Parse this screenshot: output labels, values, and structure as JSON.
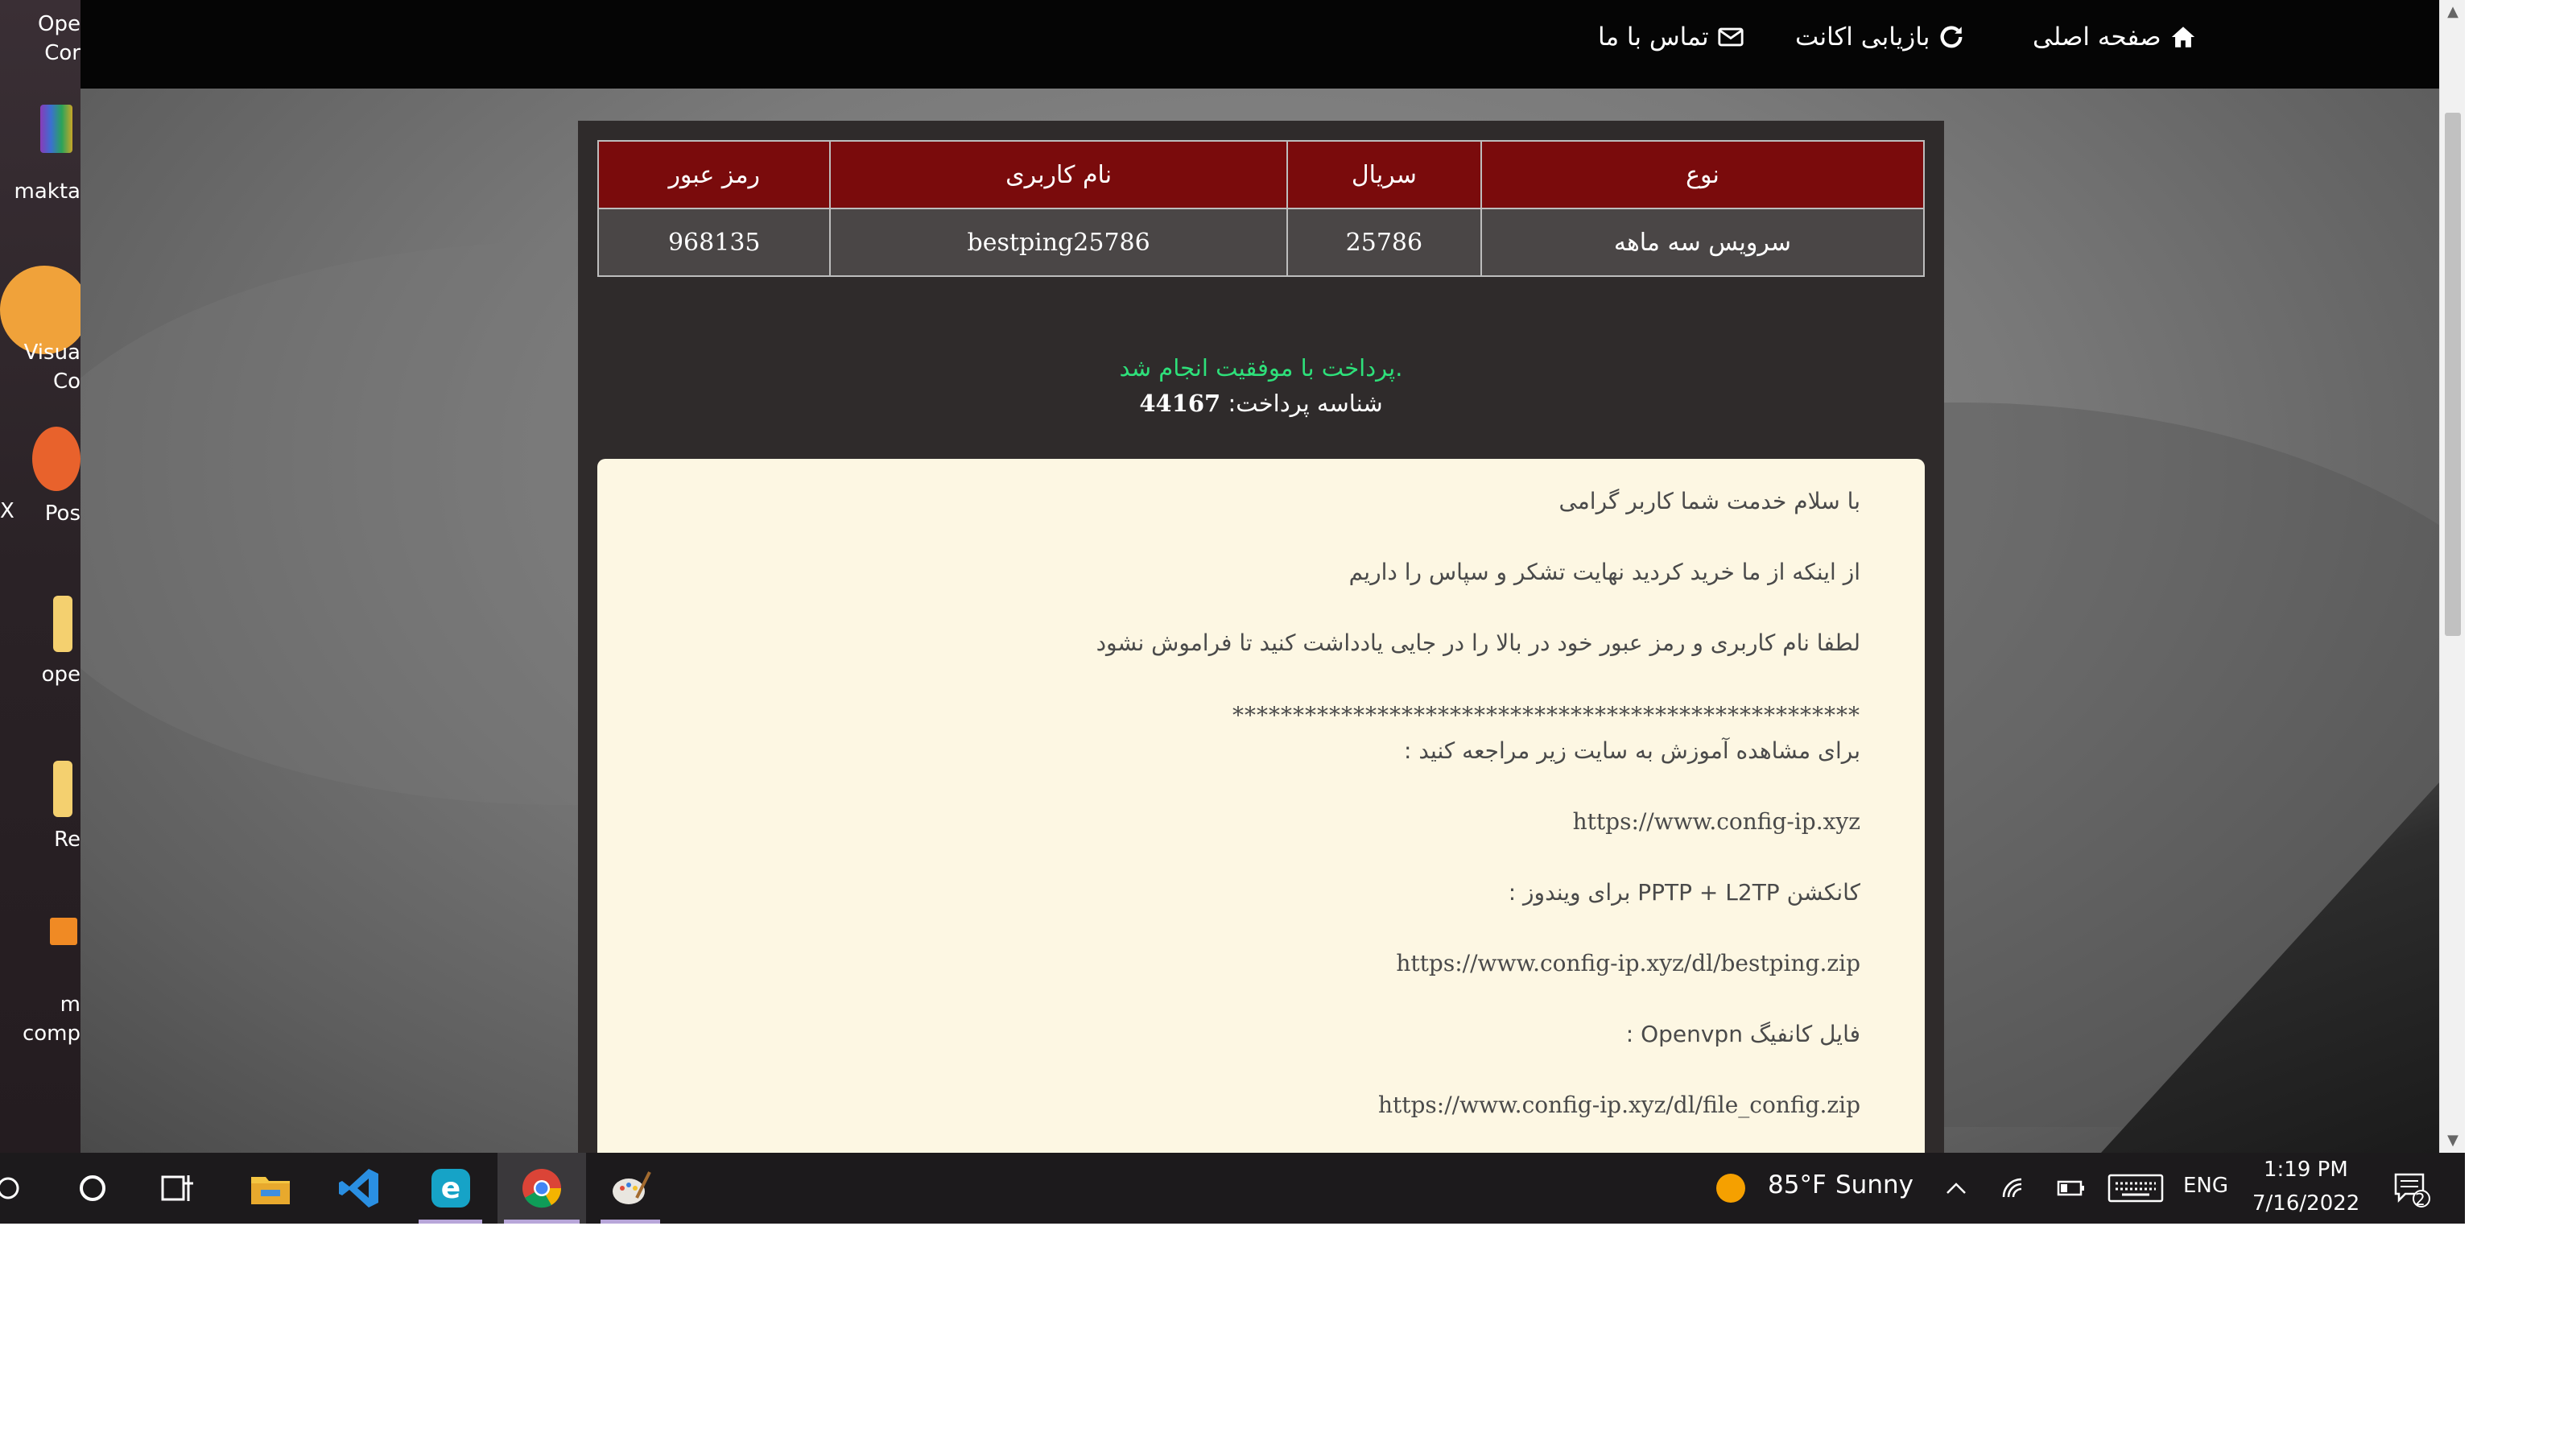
{
  "desktop": {
    "items": [
      {
        "label": "Ope",
        "label2": "Cor"
      },
      {
        "label": "makta"
      },
      {
        "label": "Visua",
        "label2": "Co"
      },
      {
        "label": "X",
        "label2": "Pos"
      },
      {
        "label": "ope"
      },
      {
        "label": "Re"
      },
      {
        "label": "m",
        "label2": "comp"
      }
    ]
  },
  "nav": {
    "home": "صفحه اصلی",
    "recover": "بازیابی اکانت",
    "contact": "تماس با ما"
  },
  "table": {
    "headers": [
      "نوع",
      "سریال",
      "نام کاربری",
      "رمز عبور"
    ],
    "row": [
      "سرویس سه ماهه",
      "25786",
      "bestping25786",
      "968135"
    ]
  },
  "status": {
    "success": "پرداخت با موفقیت انجام شد.",
    "payment_id_label": "شناسه پرداخت:",
    "payment_id": "44167"
  },
  "message": {
    "line1": "با سلام خدمت شما کاربر گرامی",
    "line2": "از اینکه از ما خرید کردید نهایت تشکر و سپاس را داریم",
    "line3": "لطفا نام کاربری و رمز عبور خود در بالا را در جایی یادداشت کنید تا فراموش نشود",
    "separator": "****************************************************",
    "line4": "برای مشاهده آموزش به سایت زیر مراجعه کنید :",
    "url1": "https://www.config-ip.xyz",
    "line5": "کانکشن PPTP + L2TP برای ویندوز :",
    "url2": "https://www.config-ip.xyz/dl/bestping.zip",
    "line6": "فایل کانفیگ Openvpn :",
    "url3": "https://www.config-ip.xyz/dl/file_config.zip"
  },
  "taskbar": {
    "weather_temp": "85°F",
    "weather_desc": "Sunny",
    "language": "ENG",
    "time": "1:19 PM",
    "date": "7/16/2022",
    "notification_count": "2"
  },
  "colors": {
    "navbar": "#050505",
    "table_header": "#7a0b0c",
    "table_cell": "#4a4646",
    "panel": "#2f2b2b",
    "success_text": "#2ee07a",
    "message_bg": "#fdf7e3"
  }
}
